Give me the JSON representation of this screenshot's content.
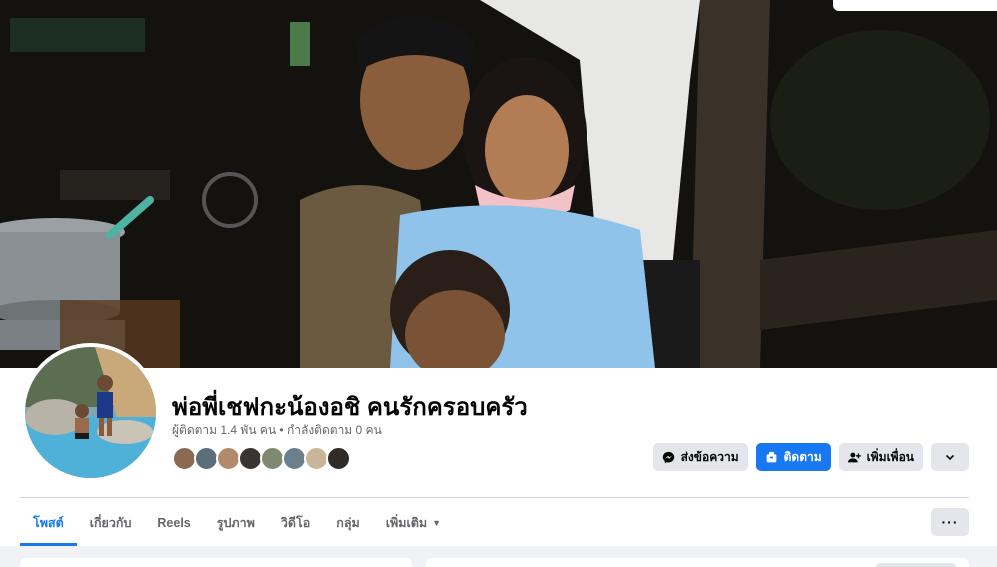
{
  "cover": {
    "alt_icon": "cover-photo"
  },
  "profile": {
    "name": "พ่อพี่เชฟกะน้องอชิ คนรักครอบครัว",
    "followers": "ผู้ติดตาม 1.4 พัน คน",
    "separator": " • ",
    "following": "กำลังติดตาม 0 คน"
  },
  "actions": {
    "message_label": "ส่งข้อความ",
    "follow_label": "ติดตาม",
    "add_friend_label": "เพิ่มเพื่อน"
  },
  "tabs": [
    {
      "label": "โพสต์",
      "active": true
    },
    {
      "label": "เกี่ยวกับ"
    },
    {
      "label": "Reels"
    },
    {
      "label": "รูปภาพ"
    },
    {
      "label": "วิดีโอ"
    },
    {
      "label": "กลุ่ม"
    },
    {
      "label": "เพิ่มเติม"
    }
  ],
  "colors": {
    "accent": "#1877f2",
    "secondary_button": "#e4e6eb",
    "background": "#f0f2f5",
    "muted_text": "#65676b"
  },
  "icons": {
    "message": "messenger-icon",
    "follow": "follow-icon",
    "add_friend": "add-friend-icon",
    "dropdown": "chevron-down-icon",
    "more": "more-dots-icon"
  }
}
